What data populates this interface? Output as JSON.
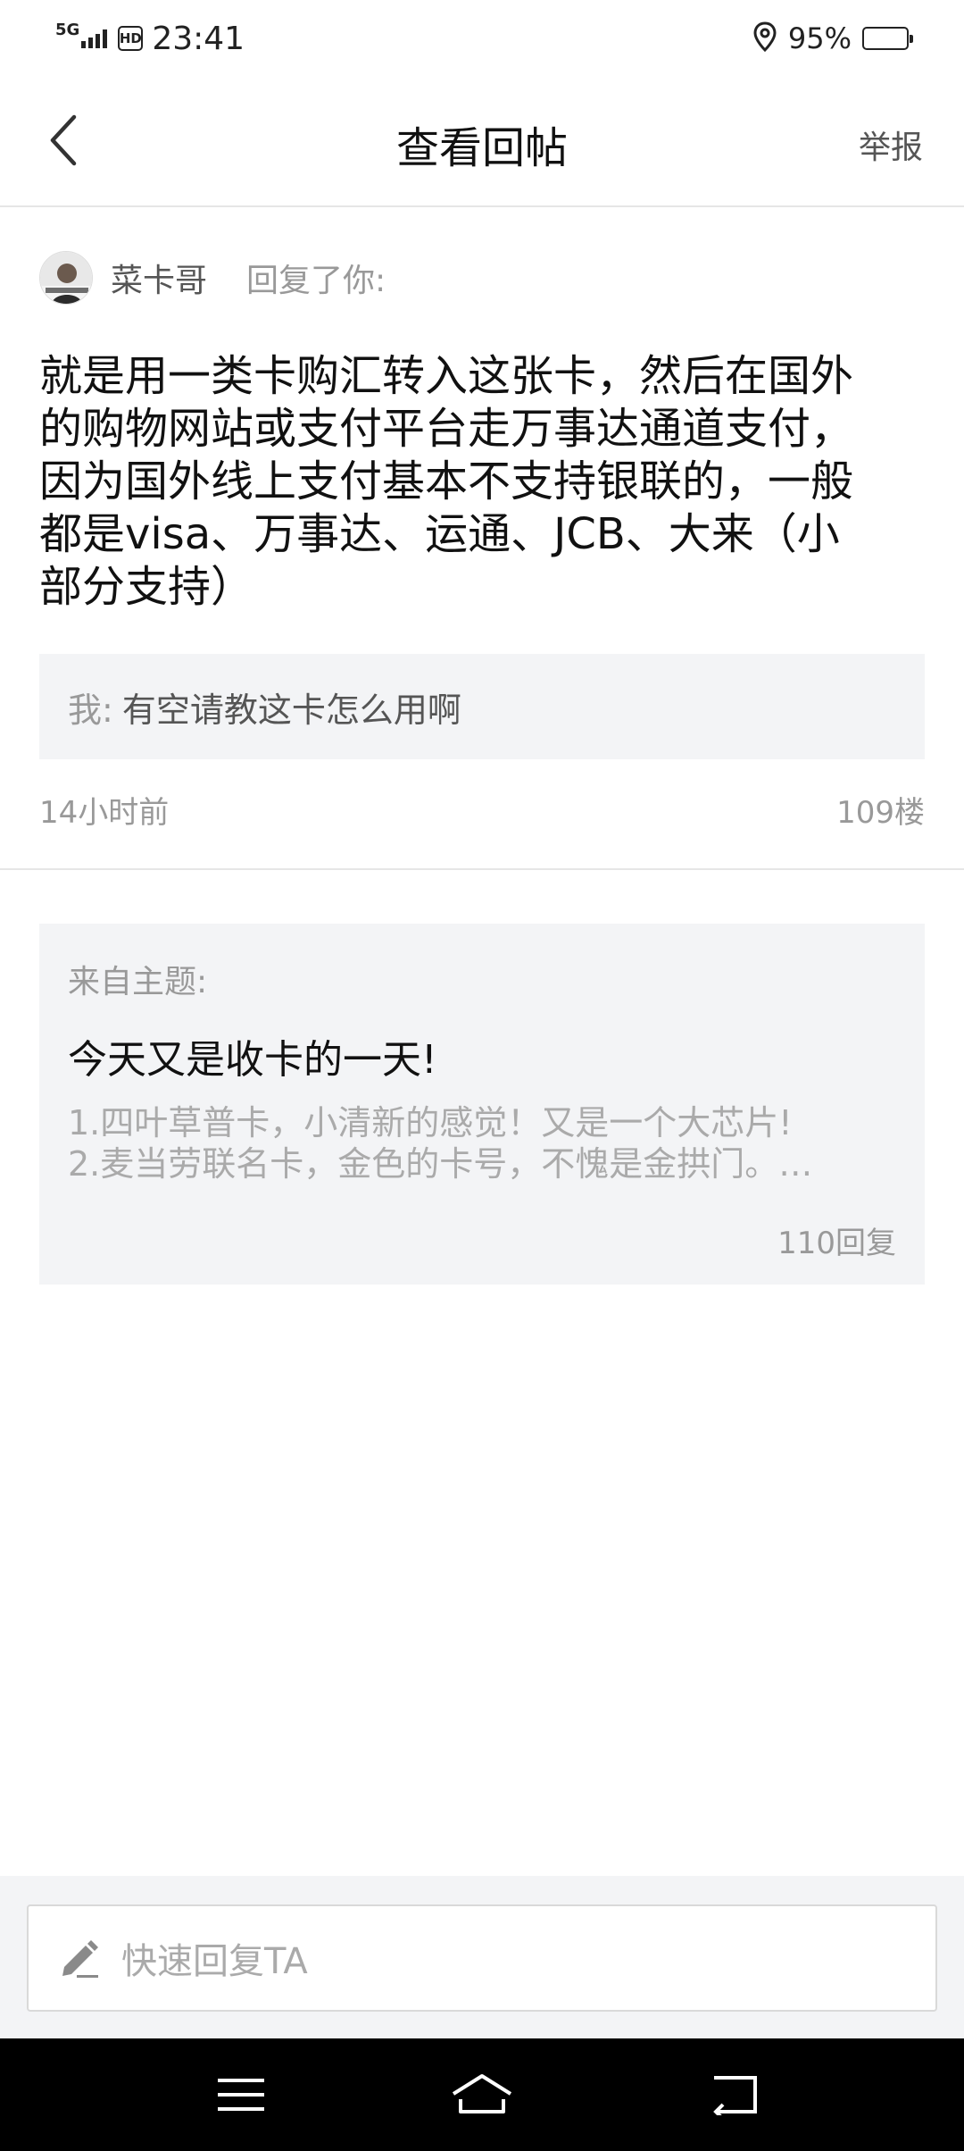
{
  "status_bar": {
    "network": "5G",
    "hd": "HD",
    "time": "23:41",
    "battery": "95%",
    "battery_level": 0.95
  },
  "nav": {
    "title": "查看回帖",
    "report_label": "举报",
    "back_icon": "chevron-left-icon"
  },
  "reply": {
    "author": "菜卡哥",
    "verb": "回复了你:",
    "body_lines": [
      "就是用一类卡购汇转入这张卡，然后在国外",
      "的购物网站或支付平台走万事达通道支付，",
      "因为国外线上支付基本不支持银联的，一般",
      "都是visa、万事达、运通、JCB、大来（小",
      "部分支持）"
    ],
    "quote_prefix": "我:",
    "quote_text": "有空请教这卡怎么用啊",
    "time": "14小时前",
    "floor": "109楼"
  },
  "topic": {
    "from_label": "来自主题:",
    "title": "今天又是收卡的一天!",
    "excerpt_lines": [
      "1.四叶草普卡，小清新的感觉！又是一个大芯片!",
      "2.麦当劳联名卡，金色的卡号，不愧是金拱门。…"
    ],
    "replies": "110回复"
  },
  "input": {
    "placeholder": "快速回复TA",
    "icon": "pencil-icon"
  },
  "system_nav": {
    "menu_icon": "menu-icon",
    "home_icon": "home-icon",
    "back_icon": "back-icon"
  },
  "colors": {
    "text_primary": "#111111",
    "text_secondary": "#555555",
    "text_muted": "#999999",
    "card_bg": "#f3f4f6",
    "divider": "#e6e6e6",
    "system_nav_bg": "#000000"
  }
}
